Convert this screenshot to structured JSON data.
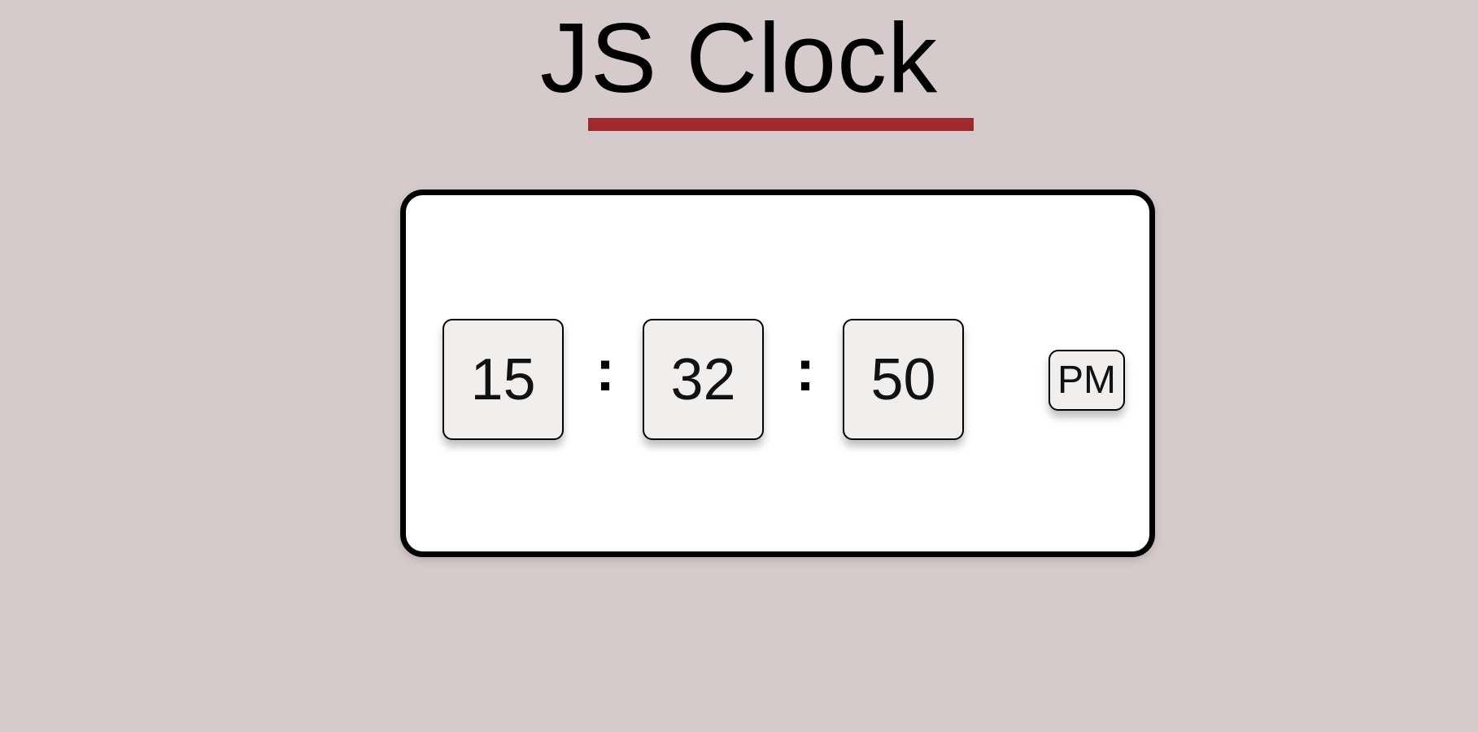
{
  "app": {
    "title": "JS Clock"
  },
  "clock": {
    "hours": "15",
    "minutes": "32",
    "seconds": "50",
    "separator": ":",
    "period": "PM"
  },
  "colors": {
    "background": "#d5cbcc",
    "accent_underline": "#a3282b",
    "card": "#ffffff",
    "digit_box": "#f1eeee",
    "text": "#000000"
  }
}
